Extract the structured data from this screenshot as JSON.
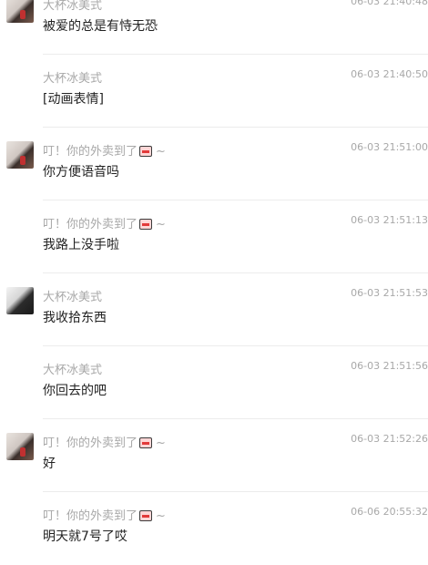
{
  "chat": {
    "messages": [
      {
        "sender": "大杯冰美式",
        "time": "06-03 21:40:48",
        "text": "被爱的总是有恃无恐",
        "avatar": "avatar-a",
        "emoji": null
      },
      {
        "sender": "大杯冰美式",
        "time": "06-03 21:40:50",
        "text": "[动画表情]",
        "avatar": null,
        "emoji": null
      },
      {
        "sender": "叮！你的外卖到了",
        "time": "06-03 21:51:00",
        "text": "你方便语音吗",
        "avatar": "avatar-a",
        "emoji": "takeout-box-icon",
        "tilde": "~"
      },
      {
        "sender": "叮！你的外卖到了",
        "time": "06-03 21:51:13",
        "text": "我路上没手啦",
        "avatar": null,
        "emoji": "takeout-box-icon",
        "tilde": "~"
      },
      {
        "sender": "大杯冰美式",
        "time": "06-03 21:51:53",
        "text": "我收拾东西",
        "avatar": "avatar-b",
        "emoji": null
      },
      {
        "sender": "大杯冰美式",
        "time": "06-03 21:51:56",
        "text": "你回去的吧",
        "avatar": null,
        "emoji": null
      },
      {
        "sender": "叮！你的外卖到了",
        "time": "06-03 21:52:26",
        "text": "好",
        "avatar": "avatar-a",
        "emoji": "takeout-box-icon",
        "tilde": "~"
      },
      {
        "sender": "叮！你的外卖到了",
        "time": "06-06 20:55:32",
        "text": "明天就7号了哎",
        "avatar": null,
        "emoji": "takeout-box-icon",
        "tilde": "~"
      }
    ]
  },
  "colors": {
    "meta": "#a8a8a8",
    "text": "#222222",
    "divider": "#ececec"
  }
}
